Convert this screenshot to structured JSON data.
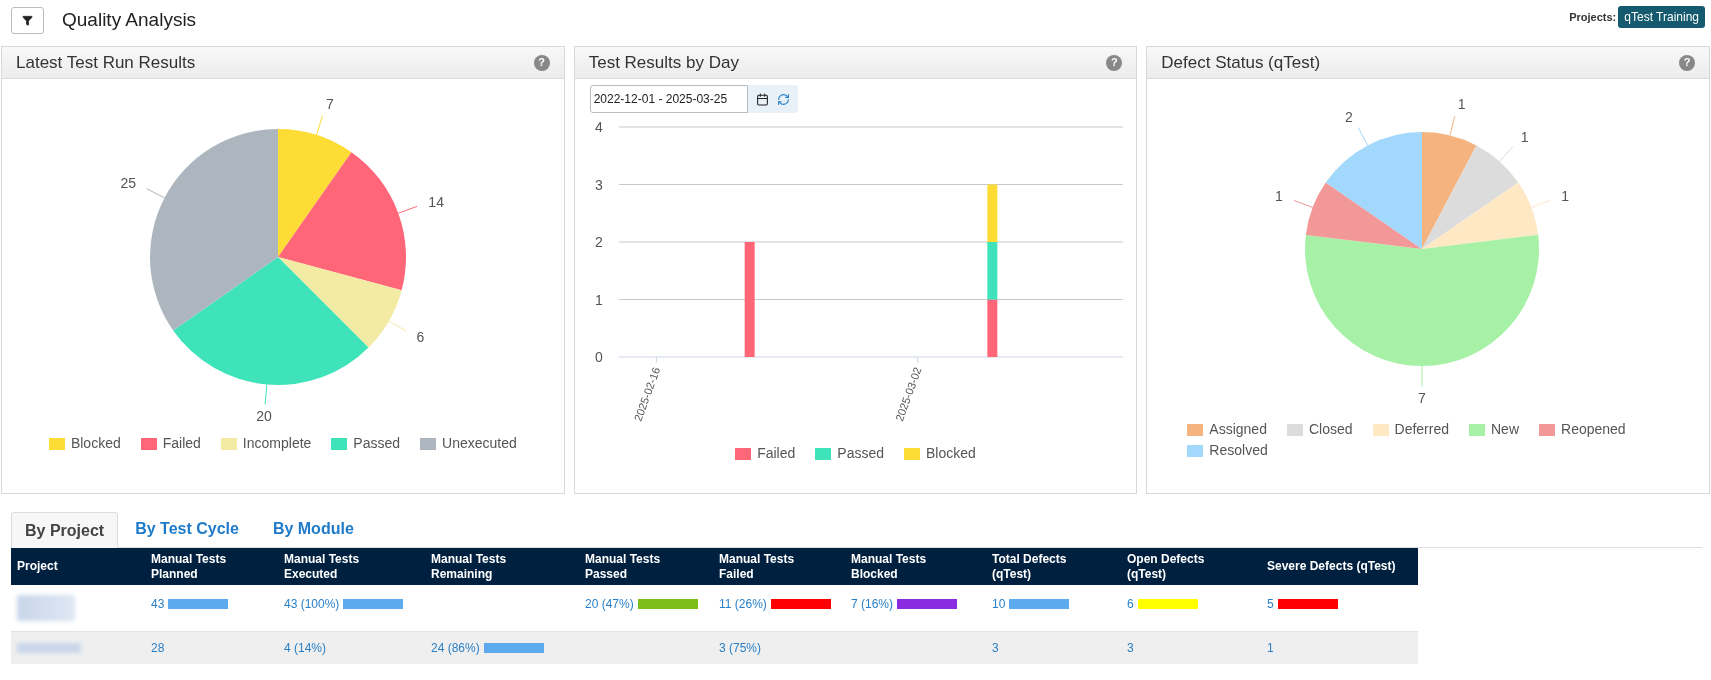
{
  "header": {
    "title": "Quality Analysis",
    "projects_label": "Projects:",
    "project_badge": "qTest Training"
  },
  "panels": [
    {
      "title": "Latest Test Run Results",
      "help": "?",
      "chart_data": {
        "type": "pie",
        "categories": [
          "Blocked",
          "Failed",
          "Incomplete",
          "Passed",
          "Unexecuted"
        ],
        "values": [
          7,
          14,
          6,
          20,
          25
        ],
        "colors": [
          "#fddc35",
          "#ff6779",
          "#f3eaa4",
          "#3ee3b9",
          "#adb5be"
        ],
        "data_labels": true,
        "legend": "bottom"
      }
    },
    {
      "title": "Test Results by Day",
      "help": "?",
      "date_range": "2022-12-01 - 2025-03-25",
      "chart_data": {
        "type": "bar",
        "stacked": true,
        "grid": true,
        "legend": "bottom",
        "x": [
          "2025-02-21",
          "2025-03-06"
        ],
        "series": [
          {
            "name": "Failed",
            "color": "#ff6779",
            "values": [
              2,
              1
            ]
          },
          {
            "name": "Passed",
            "color": "#3ee3b9",
            "values": [
              0,
              1
            ]
          },
          {
            "name": "Blocked",
            "color": "#fddc35",
            "values": [
              0,
              1
            ]
          }
        ],
        "xlim": [
          "2025-02-14",
          "2025-03-13"
        ],
        "ylim": [
          0,
          4
        ],
        "yticks": [
          0,
          1,
          2,
          3,
          4
        ],
        "xticks": [
          {
            "value": "2025-02-16",
            "label": "2025-02-16"
          },
          {
            "value": "2025-03-02",
            "label": "2025-03-02"
          }
        ]
      }
    },
    {
      "title": "Defect Status (qTest)",
      "help": "?",
      "chart_data": {
        "type": "pie",
        "categories": [
          "Assigned",
          "Closed",
          "Deferred",
          "New",
          "Reopened",
          "Resolved"
        ],
        "values": [
          1,
          1,
          1,
          7,
          1,
          2
        ],
        "colors": [
          "#f5b47f",
          "#dcdcdc",
          "#ffe8c4",
          "#a6f1a6",
          "#f29898",
          "#a2d8fb"
        ],
        "data_labels": true,
        "legend": "bottom"
      }
    }
  ],
  "tabs": [
    {
      "label": "By Project",
      "selected": true
    },
    {
      "label": "By Test Cycle",
      "selected": false
    },
    {
      "label": "By Module",
      "selected": false
    }
  ],
  "table": {
    "columns": [
      "Project",
      "Manual Tests Planned",
      "Manual Tests Executed",
      "Manual Tests Remaining",
      "Manual Tests Passed",
      "Manual Tests Failed",
      "Manual Tests Blocked",
      "Total Defects (qTest)",
      "Open Defects (qTest)",
      "Severe Defects (qTest)"
    ],
    "rows": [
      {
        "cells": [
          {
            "blurred": true
          },
          {
            "text": "43",
            "bar": {
              "color": "#5eaaee"
            }
          },
          {
            "text": "43 (100%)",
            "bar": {
              "color": "#5eaaee"
            }
          },
          null,
          {
            "text": "20 (47%)",
            "bar": {
              "color": "#7cbf1b"
            }
          },
          {
            "text": "11 (26%)",
            "bar": {
              "color": "#ff0000"
            }
          },
          {
            "text": "7 (16%)",
            "bar": {
              "color": "#8a2be2"
            }
          },
          {
            "text": "10",
            "bar": {
              "color": "#5eaaee"
            }
          },
          {
            "text": "6",
            "bar": {
              "color": "#ffff00"
            }
          },
          {
            "text": "5",
            "bar": {
              "color": "#ff0000"
            }
          }
        ]
      },
      {
        "cells": [
          {
            "blurred": true
          },
          {
            "text": "28"
          },
          {
            "text": "4 (14%)"
          },
          {
            "text": "24 (86%)",
            "bar": {
              "color": "#5eaaee"
            }
          },
          null,
          {
            "text": "3 (75%)"
          },
          null,
          {
            "text": "3"
          },
          {
            "text": "3"
          },
          {
            "text": "1"
          }
        ]
      }
    ]
  }
}
